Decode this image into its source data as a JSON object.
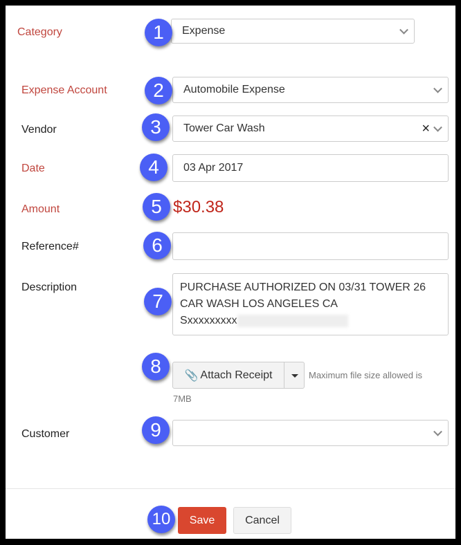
{
  "form": {
    "category": {
      "label": "Category",
      "value": "Expense"
    },
    "expense_account": {
      "label": "Expense Account",
      "value": "Automobile Expense"
    },
    "vendor": {
      "label": "Vendor",
      "value": "Tower Car Wash",
      "clear": "×"
    },
    "date": {
      "label": "Date",
      "value": "03 Apr 2017"
    },
    "amount": {
      "label": "Amount",
      "value": "$30.38"
    },
    "reference": {
      "label": "Reference#",
      "value": ""
    },
    "description": {
      "label": "Description",
      "line1": "PURCHASE AUTHORIZED ON 03/31 TOWER 26",
      "line2": "CAR WASH LOS ANGELES CA",
      "line3": "Sxxxxxxxxx"
    },
    "attach": {
      "label": "Attach Receipt",
      "hint": "Maximum file size allowed is",
      "hint2": "7MB"
    },
    "customer": {
      "label": "Customer",
      "value": ""
    }
  },
  "footer": {
    "save": "Save",
    "cancel": "Cancel"
  },
  "badges": [
    "1",
    "2",
    "3",
    "4",
    "5",
    "6",
    "7",
    "8",
    "9",
    "10"
  ],
  "colors": {
    "badge": "#4b5ff5",
    "required_label": "#c0463e",
    "save": "#d9472f",
    "amount": "#c0261b"
  }
}
